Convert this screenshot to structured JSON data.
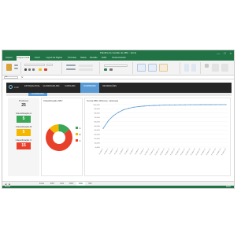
{
  "window": {
    "title": "Planilha de Gestão de ABC - Excel",
    "controls": [
      "—",
      "□",
      "×"
    ]
  },
  "ribbon_tabs": [
    "Arquivo",
    "Página Inicial",
    "Inserir",
    "Layout da Página",
    "Fórmulas",
    "Dados",
    "Revisão",
    "Exibir",
    "Desenvolvedor"
  ],
  "name_box": "A1",
  "fx": "fx",
  "nav": {
    "logo": "LUZ",
    "buttons": [
      "ESTOQUE ATUAL",
      "CLASSIFICAR ABC",
      "CURVA ABC",
      "DASHBOARD",
      "INFORMAÇÕES"
    ],
    "active_index": 3
  },
  "subtab": "DASHBOARD",
  "kpis": {
    "produtos_label": "Produtos",
    "produtos_value": "25",
    "a_label": "Classificação A",
    "a_value": "5",
    "b_label": "Classificação B",
    "b_value": "5",
    "c_label": "Classificação C",
    "c_value": "15"
  },
  "colors": {
    "a": "#3aa757",
    "b": "#f5b800",
    "c": "#e8412b",
    "accent": "#5b9bd5",
    "excel_green": "#217346"
  },
  "donut_title": "Classificação ABC",
  "donut": [
    {
      "label": "C",
      "value": 73,
      "color": "#e8412b"
    },
    {
      "label": "B",
      "value": 12,
      "color": "#f5b800"
    },
    {
      "label": "A",
      "value": 15,
      "color": "#3aa757"
    }
  ],
  "line_title": "Curva ABC (Pareto) - Estoque",
  "chart_data": {
    "type": "line",
    "title": "Curva ABC (Pareto) - Estoque",
    "x": [
      "Produto 1",
      "Produto 2",
      "Produto 3",
      "Produto 4",
      "Produto 5",
      "Produto 6",
      "Produto 7",
      "Produto 8",
      "Produto 9",
      "Produto 10",
      "Produto 11",
      "Produto 12",
      "Produto 13",
      "Produto 14",
      "Produto 15",
      "Produto 16",
      "Produto 17",
      "Produto 18",
      "Produto 19",
      "Produto 20",
      "Produto 21",
      "Produto 22",
      "Produto 23",
      "Produto 24",
      "Produto 25"
    ],
    "y": [
      44,
      62,
      74,
      82,
      88,
      91.5,
      94,
      95.5,
      96.6,
      97.4,
      98,
      98.4,
      98.8,
      99.1,
      99.3,
      99.5,
      99.6,
      99.7,
      99.8,
      99.85,
      99.9,
      99.93,
      99.96,
      99.98,
      100
    ],
    "ylim": [
      0,
      100
    ],
    "yticks": [
      "0,00%",
      "10,00%",
      "20,00%",
      "30,00%",
      "40,00%",
      "50,00%",
      "60,00%",
      "70,00%",
      "80,00%",
      "90,00%",
      "100,00%"
    ]
  },
  "sheet_tabs": [
    "Início",
    "EST",
    "CLS",
    "CRV",
    "DSH",
    "INF"
  ],
  "active_sheet": 4,
  "status": {
    "left": "Pronto",
    "right": "100%"
  }
}
